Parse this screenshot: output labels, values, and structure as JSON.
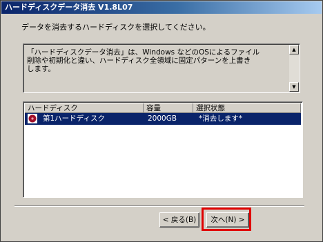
{
  "window": {
    "title": "ハードディスクデータ消去 V1.8L07"
  },
  "instruction": "データを消去するハードディスクを選択してください。",
  "description": "「ハードディスクデータ消去」は、Windows などのOSによるファイル\n削除や初期化と違い、ハードディスク全領域に固定パターンを上書き\nします。",
  "scrollbar": {
    "up": "▲",
    "down": "▼"
  },
  "list": {
    "columns": [
      "ハードディスク",
      "容量",
      "選択状態"
    ],
    "rows": [
      {
        "name": "第1ハードディスク",
        "capacity": "2000GB",
        "status": "*消去します*",
        "icon": "hard-disk-icon",
        "selected": true
      }
    ]
  },
  "buttons": {
    "back": "< 戻る(B)",
    "next": "次へ(N) >"
  },
  "colors": {
    "highlight": "#e00000",
    "selection": "#0a246a",
    "titlebar": "#0a246a"
  }
}
